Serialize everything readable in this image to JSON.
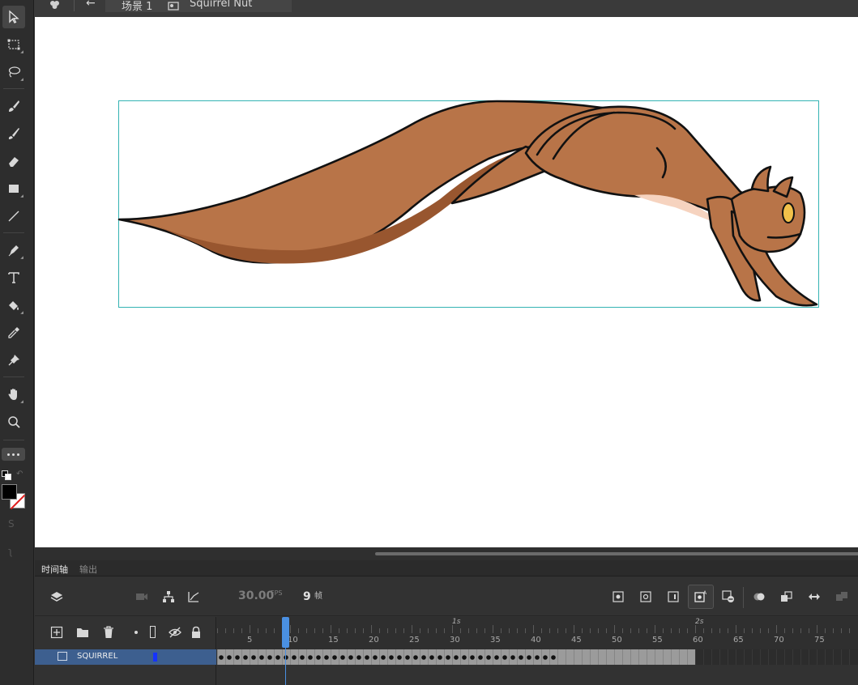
{
  "topbar": {
    "scene_label": "场景 1",
    "symbol_label": "Squirrel Nut"
  },
  "panel_tabs": {
    "timeline": "时间轴",
    "output": "输出"
  },
  "timeline": {
    "fps_value": "30.00",
    "fps_unit": "FPS",
    "current_frame": "9",
    "frame_unit": "帧",
    "total_filled_frames": 59,
    "second_markers": [
      "1s",
      "2s"
    ],
    "tick_labels": [
      "5",
      "10",
      "15",
      "20",
      "25",
      "30",
      "35",
      "40",
      "45",
      "50",
      "55",
      "60",
      "65",
      "70",
      "75"
    ]
  },
  "layers": [
    {
      "name": "SQUIRREL",
      "selected": true,
      "color": "#1533ff"
    }
  ],
  "colors": {
    "stage": "#ffffff",
    "squirrel_body": "#b87448",
    "squirrel_shadow": "#98562f",
    "squirrel_belly": "#f6d3bf",
    "squirrel_eye": "#f2c14a",
    "selection_box": "#34b3b3",
    "selected_layer": "#3d5f8f",
    "playhead": "#4a90e2"
  },
  "tools": [
    "selection-tool",
    "free-transform-tool",
    "lasso-tool",
    "paint-brush-tool",
    "brush-tool",
    "eraser-tool",
    "rectangle-tool",
    "line-tool",
    "pen-tool",
    "text-tool",
    "paint-bucket-tool",
    "eyedropper-tool",
    "pin-tool",
    "hand-tool",
    "zoom-tool"
  ]
}
